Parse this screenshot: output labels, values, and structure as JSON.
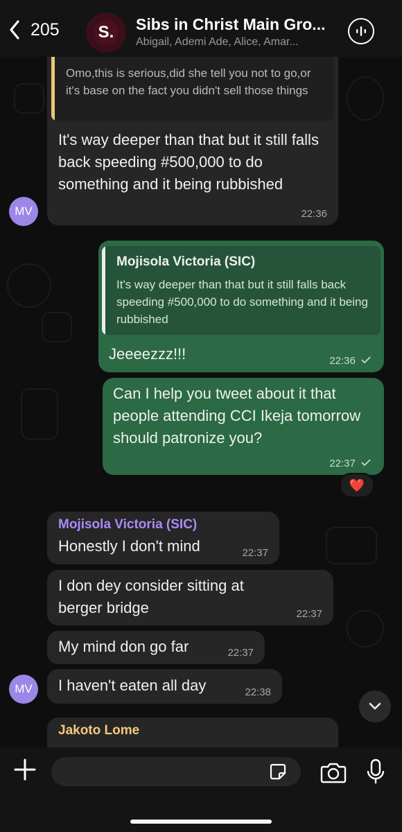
{
  "header": {
    "back_count": "205",
    "title": "Sibs in Christ Main Gro...",
    "subtitle": "Abigail, Ademi Ade, Alice, Amar...",
    "group_logo_letter": "S.",
    "group_logo_color": "#3a0e1a"
  },
  "messages": {
    "m1": {
      "quote_text": "Omo,this is serious,did she tell you not to go,or it's base on the fact you didn't sell those things",
      "text": "It's way deeper than that but it still falls back speeding #500,000 to do something and it being rubbished",
      "time": "22:36",
      "avatar": "MV"
    },
    "m2": {
      "quote_sender": "Mojisola Victoria (SIC)",
      "quote_text": "It's way deeper than that but it still falls back speeding #500,000 to do something and it being rubbished",
      "text": "Jeeeezzz!!!",
      "time": "22:36"
    },
    "m3": {
      "text": "Can I help you tweet about it that people attending CCI Ikeja tomorrow should patronize you?",
      "time": "22:37",
      "reaction": "❤️"
    },
    "m4": {
      "sender": "Mojisola Victoria (SIC)",
      "text": "Honestly I don't mind",
      "time": "22:37"
    },
    "m5": {
      "text": "I don dey consider sitting at berger bridge",
      "time": "22:37"
    },
    "m6": {
      "text": "My mind don go far",
      "time": "22:37"
    },
    "m7": {
      "text": "I haven't eaten all day",
      "time": "22:38",
      "avatar": "MV"
    },
    "m8": {
      "sender": "Jakoto Lome"
    }
  },
  "colors": {
    "outgoing_bubble": "#2b6a44",
    "incoming_bubble": "#262626",
    "sender_mojisola": "#a78bfa",
    "sender_jakoto": "#f5c97a",
    "quote_bar_yellow": "#e8c77a"
  },
  "icons": {
    "back": "chevron-left-icon",
    "voice": "voice-chat-icon",
    "plus": "plus-icon",
    "sticker": "sticker-icon",
    "camera": "camera-icon",
    "mic": "microphone-icon",
    "scroll": "chevron-down-icon",
    "read": "single-check-icon"
  }
}
